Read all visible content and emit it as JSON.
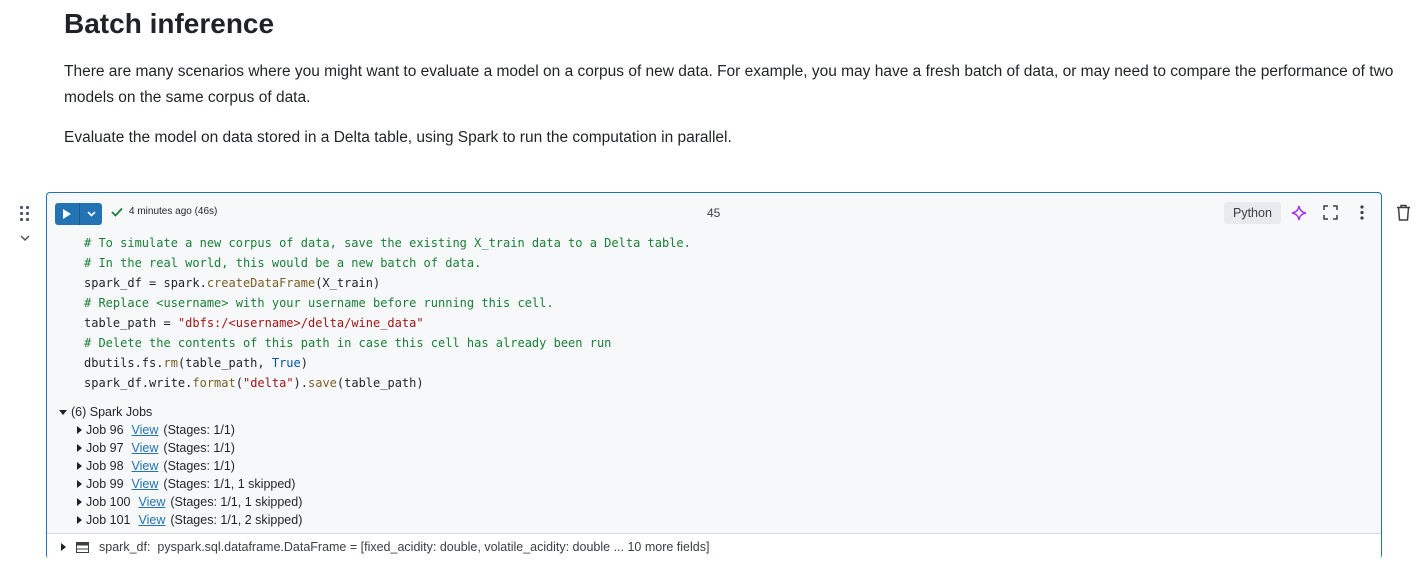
{
  "heading": "Batch inference",
  "paragraphs": [
    "There are many scenarios where you might want to evaluate a model on a corpus of new data. For example, you may have a fresh batch of data, or may need to compare the performance of two models on the same corpus of data.",
    "Evaluate the model on data stored in a Delta table, using Spark to run the computation in parallel."
  ],
  "cell": {
    "status": "4 minutes ago (46s)",
    "number": "45",
    "language": "Python",
    "code": {
      "comment1": "# To simulate a new corpus of data, save the existing X_train data to a Delta table.",
      "comment2": "# In the real world, this would be a new batch of data.",
      "line3_a": "spark_df = spark.",
      "line3_fn": "createDataFrame",
      "line3_b": "(X_train)",
      "comment4": "# Replace <username> with your username before running this cell.",
      "line5_a": "table_path = ",
      "line5_str": "\"dbfs:/<username>/delta/wine_data\"",
      "comment6": "# Delete the contents of this path in case this cell has already been run",
      "line7_a": "dbutils.fs.",
      "line7_fn": "rm",
      "line7_b": "(table_path, ",
      "line7_kw": "True",
      "line7_c": ")",
      "line8_a": "spark_df.write.",
      "line8_fn1": "format",
      "line8_b": "(",
      "line8_str": "\"delta\"",
      "line8_c": ").",
      "line8_fn2": "save",
      "line8_d": "(table_path)"
    },
    "jobs_header": "(6) Spark Jobs",
    "jobs": [
      {
        "label": "Job 96",
        "view": "View",
        "stages": "(Stages: 1/1)"
      },
      {
        "label": "Job 97",
        "view": "View",
        "stages": "(Stages: 1/1)"
      },
      {
        "label": "Job 98",
        "view": "View",
        "stages": "(Stages: 1/1)"
      },
      {
        "label": "Job 99",
        "view": "View",
        "stages": "(Stages: 1/1, 1 skipped)"
      },
      {
        "label": "Job 100",
        "view": "View",
        "stages": "(Stages: 1/1, 1 skipped)"
      },
      {
        "label": "Job 101",
        "view": "View",
        "stages": "(Stages: 1/1, 2 skipped)"
      }
    ],
    "result": {
      "name": "spark_df:",
      "type": "pyspark.sql.dataframe.DataFrame = [fixed_acidity: double, volatile_acidity: double ... 10 more fields]"
    }
  },
  "colors": {
    "accent": "#2272b4",
    "success": "#1a7f37",
    "comment": "#1a7f37",
    "string": "#a31515"
  },
  "icons": [
    "run-icon",
    "chevron-down-icon",
    "check-icon",
    "sparkle-icon",
    "fullscreen-icon",
    "more-vertical-icon",
    "trash-icon",
    "drag-handle-icon",
    "table-icon"
  ]
}
